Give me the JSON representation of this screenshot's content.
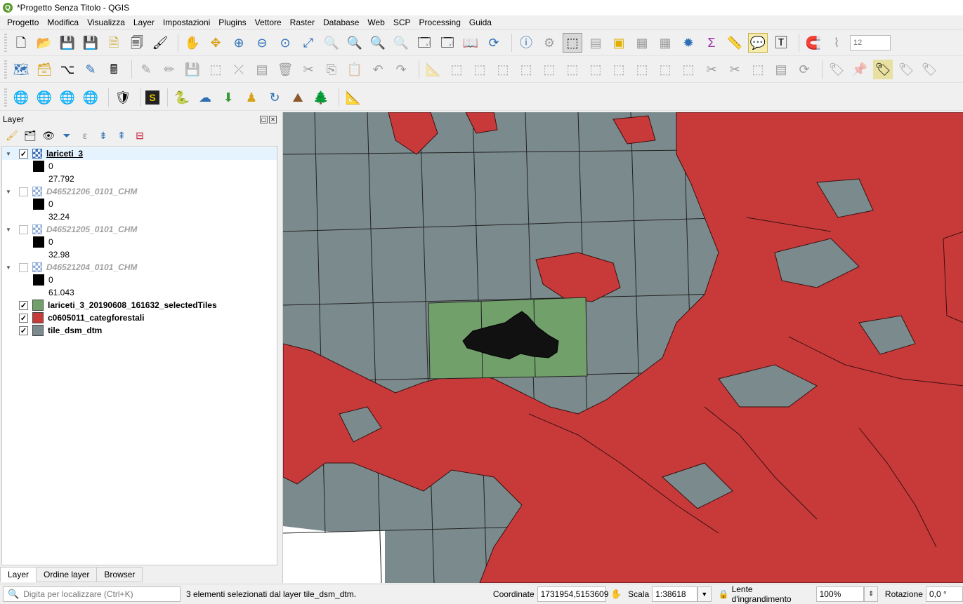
{
  "window": {
    "title": "*Progetto Senza Titolo - QGIS",
    "app_icon": "qgis-logo-icon"
  },
  "menu": [
    {
      "label": "Progetto"
    },
    {
      "label": "Modifica"
    },
    {
      "label": "Visualizza"
    },
    {
      "label": "Layer"
    },
    {
      "label": "Impostazioni"
    },
    {
      "label": "Plugins"
    },
    {
      "label": "Vettore"
    },
    {
      "label": "Raster"
    },
    {
      "label": "Database"
    },
    {
      "label": "Web"
    },
    {
      "label": "SCP"
    },
    {
      "label": "Processing"
    },
    {
      "label": "Guida"
    }
  ],
  "toolbar": {
    "font_size_value": "12"
  },
  "layers_panel": {
    "title": "Layer",
    "layers": [
      {
        "name": "lariceti_3",
        "checked": true,
        "kind": "raster",
        "min": "0",
        "max": "27.792"
      },
      {
        "name": "D46521206_0101_CHM",
        "checked": false,
        "kind": "raster",
        "min": "0",
        "max": "32.24"
      },
      {
        "name": "D46521205_0101_CHM",
        "checked": false,
        "kind": "raster",
        "min": "0",
        "max": "32.98"
      },
      {
        "name": "D46521204_0101_CHM",
        "checked": false,
        "kind": "raster",
        "min": "0",
        "max": "61.043"
      },
      {
        "name": "lariceti_3_20190608_161632_selectedTiles",
        "checked": true,
        "kind": "vector",
        "color": "#71a06b"
      },
      {
        "name": "c0605011_categforestali",
        "checked": true,
        "kind": "vector",
        "color": "#c83a3a"
      },
      {
        "name": "tile_dsm_dtm",
        "checked": true,
        "kind": "vector",
        "color": "#7b8a8c"
      }
    ],
    "tabs": [
      "Layer",
      "Ordine layer",
      "Browser"
    ]
  },
  "status": {
    "locator_placeholder": "Digita per localizzare (Ctrl+K)",
    "message": "3 elementi selezionati dal layer tile_dsm_dtm.",
    "coord_label": "Coordinate",
    "coord_value": "1731954,5153609",
    "scale_label": "Scala",
    "scale_value": "1:38618",
    "magnifier_label": "Lente d'ingrandimento",
    "magnifier_value": "100%",
    "rotation_label": "Rotazione",
    "rotation_value": "0,0 °"
  },
  "colors": {
    "forest": "#c83a3a",
    "tiles": "#7b8a8c",
    "selected": "#71a06b"
  }
}
